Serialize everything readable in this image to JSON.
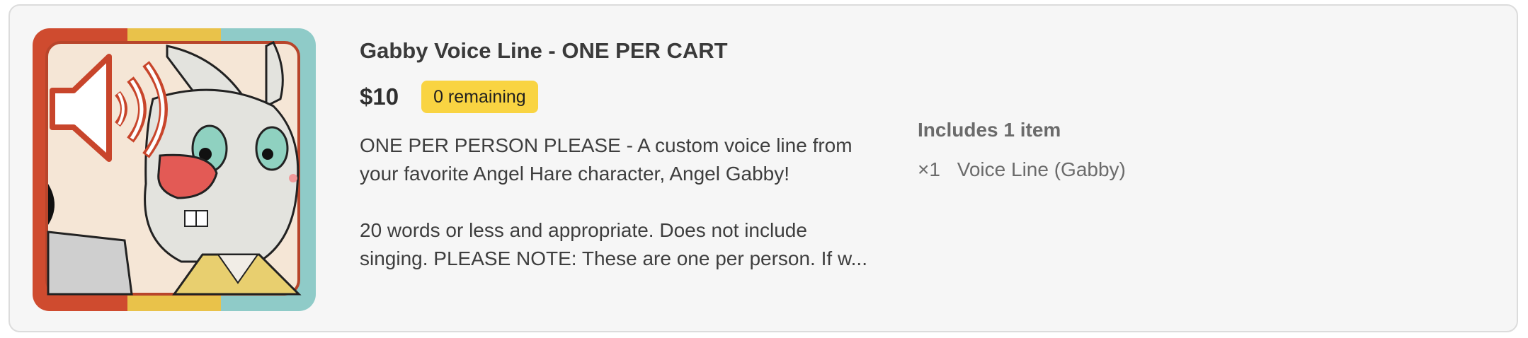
{
  "product": {
    "title": "Gabby Voice Line - ONE PER CART",
    "price": "$10",
    "stock_badge": "0 remaining",
    "description_lines": [
      "ONE PER PERSON PLEASE - A custom voice line from",
      "your favorite Angel Hare character, Angel Gabby!",
      "20 words or less and appropriate. Does not include",
      "singing. PLEASE NOTE: These are one per person. If w..."
    ],
    "image_icon": "speaker-volume-icon",
    "image_subject": "cartoon-rabbit-character"
  },
  "includes": {
    "heading": "Includes 1 item",
    "items": [
      {
        "qty": "×1",
        "name": "Voice Line (Gabby)"
      }
    ]
  },
  "colors": {
    "card_bg": "#f6f6f6",
    "badge_bg": "#f9d442",
    "stripe_red": "#cf4b2f",
    "stripe_yellow": "#e9c24a",
    "stripe_teal": "#8fcbc8"
  }
}
